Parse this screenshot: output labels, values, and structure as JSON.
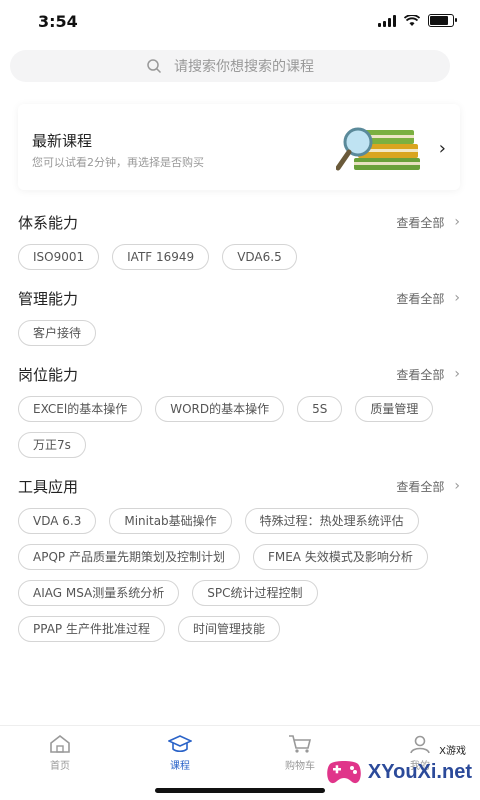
{
  "status": {
    "time": "3:54"
  },
  "search": {
    "placeholder": "请搜索你想搜索的课程"
  },
  "banner": {
    "title": "最新课程",
    "subtitle": "您可以试看2分钟，再选择是否购买"
  },
  "sections": [
    {
      "title": "体系能力",
      "more": "查看全部",
      "tags": [
        "ISO9001",
        "IATF 16949",
        "VDA6.5"
      ]
    },
    {
      "title": "管理能力",
      "more": "查看全部",
      "tags": [
        "客户接待"
      ]
    },
    {
      "title": "岗位能力",
      "more": "查看全部",
      "tags": [
        "EXCEl的基本操作",
        "WORD的基本操作",
        "5S",
        "质量管理",
        "万正7s"
      ]
    },
    {
      "title": "工具应用",
      "more": "查看全部",
      "tags": [
        "VDA 6.3",
        "Minitab基础操作",
        "特殊过程：热处理系统评估",
        "APQP 产品质量先期策划及控制计划",
        "FMEA 失效模式及影响分析",
        "AIAG MSA测量系统分析",
        "SPC统计过程控制",
        "PPAP 生产件批准过程",
        "时间管理技能"
      ]
    }
  ],
  "tabbar": {
    "tabs": [
      {
        "label": "首页"
      },
      {
        "label": "课程"
      },
      {
        "label": "购物车"
      },
      {
        "label": "我的"
      }
    ]
  },
  "watermark": {
    "text": "XYouXi.net",
    "small": "X游戏"
  },
  "colors": {
    "accent": "#2a63c8"
  }
}
